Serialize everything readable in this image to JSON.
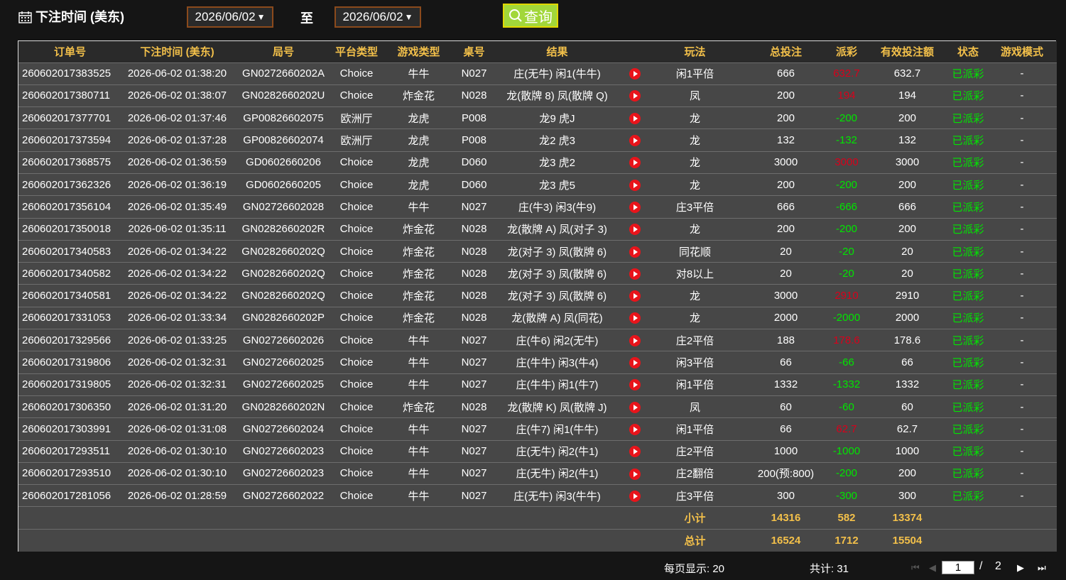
{
  "header": {
    "title": "下注时间 (美东)",
    "date_from": "2026/06/02",
    "to_label": "至",
    "date_to": "2026/06/02",
    "query_label": "查询"
  },
  "table": {
    "columns": [
      "订单号",
      "下注时间 (美东)",
      "局号",
      "平台类型",
      "游戏类型",
      "桌号",
      "结果",
      "",
      "玩法",
      "总投注",
      "派彩",
      "有效投注额",
      "状态",
      "游戏模式"
    ],
    "rows": [
      [
        "260602017383525",
        "2026-06-02 01:38:20",
        "GN0272660202A",
        "Choice",
        "牛牛",
        "N027",
        "庄(无牛) 闲1(牛牛)",
        "闲1平倍",
        "666",
        "632.7",
        "632.7",
        "已派彩",
        "-"
      ],
      [
        "260602017380711",
        "2026-06-02 01:38:07",
        "GN0282660202U",
        "Choice",
        "炸金花",
        "N028",
        "龙(散牌 8) 凤(散牌 Q)",
        "凤",
        "200",
        "194",
        "194",
        "已派彩",
        "-"
      ],
      [
        "260602017377701",
        "2026-06-02 01:37:46",
        "GP00826602075",
        "欧洲厅",
        "龙虎",
        "P008",
        "龙9 虎J",
        "龙",
        "200",
        "-200",
        "200",
        "已派彩",
        "-"
      ],
      [
        "260602017373594",
        "2026-06-02 01:37:28",
        "GP00826602074",
        "欧洲厅",
        "龙虎",
        "P008",
        "龙2 虎3",
        "龙",
        "132",
        "-132",
        "132",
        "已派彩",
        "-"
      ],
      [
        "260602017368575",
        "2026-06-02 01:36:59",
        "GD0602660206",
        "Choice",
        "龙虎",
        "D060",
        "龙3 虎2",
        "龙",
        "3000",
        "3000",
        "3000",
        "已派彩",
        "-"
      ],
      [
        "260602017362326",
        "2026-06-02 01:36:19",
        "GD0602660205",
        "Choice",
        "龙虎",
        "D060",
        "龙3 虎5",
        "龙",
        "200",
        "-200",
        "200",
        "已派彩",
        "-"
      ],
      [
        "260602017356104",
        "2026-06-02 01:35:49",
        "GN02726602028",
        "Choice",
        "牛牛",
        "N027",
        "庄(牛3) 闲3(牛9)",
        "庄3平倍",
        "666",
        "-666",
        "666",
        "已派彩",
        "-"
      ],
      [
        "260602017350018",
        "2026-06-02 01:35:11",
        "GN0282660202R",
        "Choice",
        "炸金花",
        "N028",
        "龙(散牌 A) 凤(对子 3)",
        "龙",
        "200",
        "-200",
        "200",
        "已派彩",
        "-"
      ],
      [
        "260602017340583",
        "2026-06-02 01:34:22",
        "GN0282660202Q",
        "Choice",
        "炸金花",
        "N028",
        "龙(对子 3) 凤(散牌 6)",
        "同花顺",
        "20",
        "-20",
        "20",
        "已派彩",
        "-"
      ],
      [
        "260602017340582",
        "2026-06-02 01:34:22",
        "GN0282660202Q",
        "Choice",
        "炸金花",
        "N028",
        "龙(对子 3) 凤(散牌 6)",
        "对8以上",
        "20",
        "-20",
        "20",
        "已派彩",
        "-"
      ],
      [
        "260602017340581",
        "2026-06-02 01:34:22",
        "GN0282660202Q",
        "Choice",
        "炸金花",
        "N028",
        "龙(对子 3) 凤(散牌 6)",
        "龙",
        "3000",
        "2910",
        "2910",
        "已派彩",
        "-"
      ],
      [
        "260602017331053",
        "2026-06-02 01:33:34",
        "GN0282660202P",
        "Choice",
        "炸金花",
        "N028",
        "龙(散牌 A) 凤(同花)",
        "龙",
        "2000",
        "-2000",
        "2000",
        "已派彩",
        "-"
      ],
      [
        "260602017329566",
        "2026-06-02 01:33:25",
        "GN02726602026",
        "Choice",
        "牛牛",
        "N027",
        "庄(牛6) 闲2(无牛)",
        "庄2平倍",
        "188",
        "178.6",
        "178.6",
        "已派彩",
        "-"
      ],
      [
        "260602017319806",
        "2026-06-02 01:32:31",
        "GN02726602025",
        "Choice",
        "牛牛",
        "N027",
        "庄(牛牛) 闲3(牛4)",
        "闲3平倍",
        "66",
        "-66",
        "66",
        "已派彩",
        "-"
      ],
      [
        "260602017319805",
        "2026-06-02 01:32:31",
        "GN02726602025",
        "Choice",
        "牛牛",
        "N027",
        "庄(牛牛) 闲1(牛7)",
        "闲1平倍",
        "1332",
        "-1332",
        "1332",
        "已派彩",
        "-"
      ],
      [
        "260602017306350",
        "2026-06-02 01:31:20",
        "GN0282660202N",
        "Choice",
        "炸金花",
        "N028",
        "龙(散牌 K) 凤(散牌 J)",
        "凤",
        "60",
        "-60",
        "60",
        "已派彩",
        "-"
      ],
      [
        "260602017303991",
        "2026-06-02 01:31:08",
        "GN02726602024",
        "Choice",
        "牛牛",
        "N027",
        "庄(牛7) 闲1(牛牛)",
        "闲1平倍",
        "66",
        "62.7",
        "62.7",
        "已派彩",
        "-"
      ],
      [
        "260602017293511",
        "2026-06-02 01:30:10",
        "GN02726602023",
        "Choice",
        "牛牛",
        "N027",
        "庄(无牛) 闲2(牛1)",
        "庄2平倍",
        "1000",
        "-1000",
        "1000",
        "已派彩",
        "-"
      ],
      [
        "260602017293510",
        "2026-06-02 01:30:10",
        "GN02726602023",
        "Choice",
        "牛牛",
        "N027",
        "庄(无牛) 闲2(牛1)",
        "庄2翻倍",
        "200(预:800)",
        "-200",
        "200",
        "已派彩",
        "-"
      ],
      [
        "260602017281056",
        "2026-06-02 01:28:59",
        "GN02726602022",
        "Choice",
        "牛牛",
        "N027",
        "庄(无牛) 闲3(牛牛)",
        "庄3平倍",
        "300",
        "-300",
        "300",
        "已派彩",
        "-"
      ]
    ],
    "subtotal": {
      "label": "小计",
      "total_bet": "14316",
      "payout": "582",
      "valid_bet": "13374"
    },
    "grand_total": {
      "label": "总计",
      "total_bet": "16524",
      "payout": "1712",
      "valid_bet": "15504"
    }
  },
  "pagination": {
    "per_page": "每页显示: 20",
    "total": "共计: 31",
    "current_page": "1",
    "slash": "/",
    "total_pages": "2"
  },
  "colors": {
    "accent": "#f3c04a",
    "positive": "#00e600",
    "negative": "#d9001b",
    "play": "#e8141b"
  },
  "icons": {
    "calendar": "calendar-icon",
    "search": "search-icon",
    "play": "play-video-icon"
  }
}
